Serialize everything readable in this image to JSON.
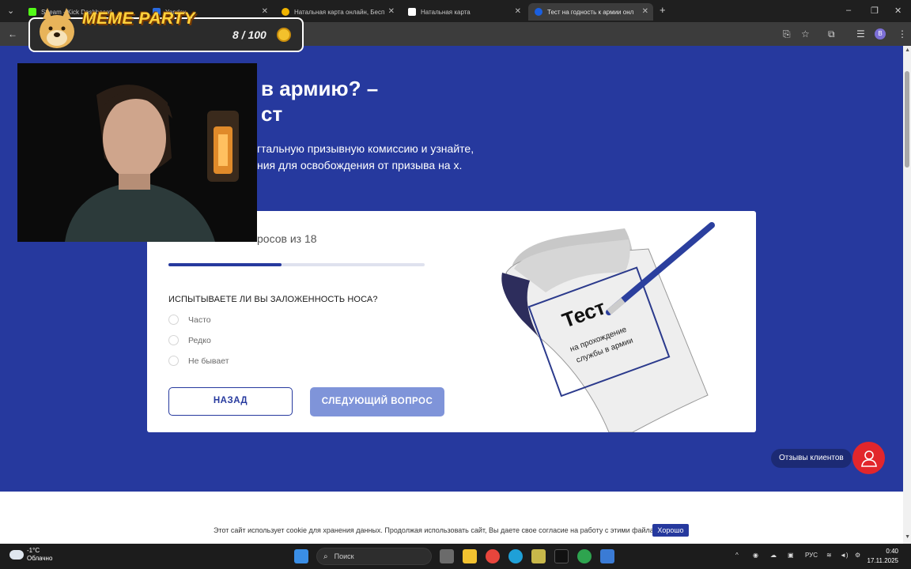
{
  "browser": {
    "tabs": [
      {
        "title": "Stream - Kick Dashboard",
        "color": "#53fc18"
      },
      {
        "title": "Yandex",
        "color": "#2a6ae0"
      },
      {
        "title": "Натальная карта онлайн, Бесп",
        "color": "#f0b400"
      },
      {
        "title": "Натальная карта",
        "color": "#ffffff"
      },
      {
        "title": "Тест на годность к армии онл",
        "color": "#1a5fe0"
      }
    ],
    "new_tab": "+",
    "profile": "B"
  },
  "meme_party": {
    "title": "MEME PARTY",
    "count": "8 / 100"
  },
  "page": {
    "title_line1": "в армию? –",
    "title_line2": "ст",
    "intro": "гтальную призывную комиссию и узнайте, ния для освобождения от призыва на х.",
    "progress_text": "росов из 18",
    "progress_fraction": 0.44,
    "question": "ИСПЫТЫВАЕТЕ ЛИ ВЫ ЗАЛОЖЕННОСТЬ НОСА?",
    "options": [
      "Часто",
      "Редко",
      "Не бывает"
    ],
    "back_button": "НАЗАД",
    "next_button": "СЛЕДУЮЩИЙ  ВОПРОС",
    "illustration": {
      "big": "Тест",
      "line1": "на прохождение",
      "line2": "службы в армии"
    },
    "reviews_label": "Отзывы клиентов",
    "cookie_text": "Этот сайт использует cookie для хранения данных. Продолжая использовать сайт, Вы даете свое согласие на работу с этими файлами.",
    "cookie_ok": "Хорошо"
  },
  "taskbar": {
    "weather_temp": "-1°C",
    "weather_desc": "Облачно",
    "search_label": "Поиск",
    "lang": "РУС",
    "time": "0:40",
    "date": "17.11.2025"
  }
}
